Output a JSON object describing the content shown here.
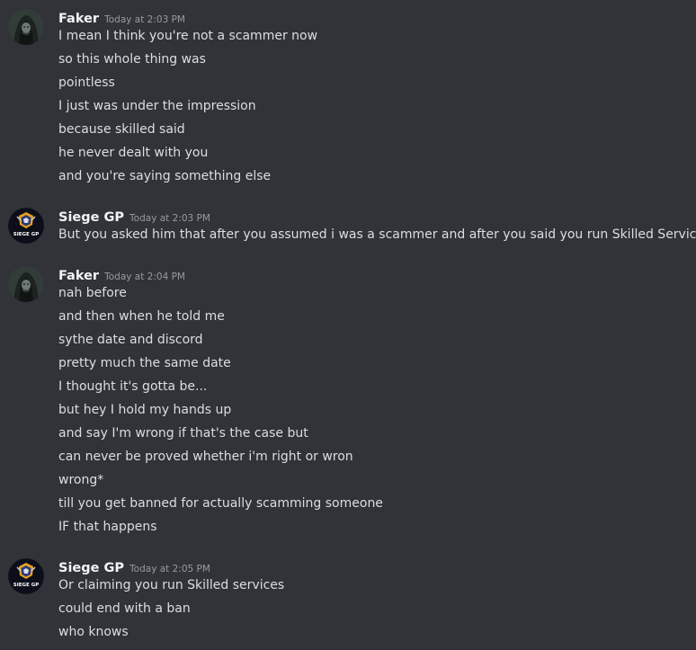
{
  "messages": [
    {
      "author": "Faker",
      "avatar_icon": "hooded-figure-avatar-icon",
      "timestamp": "Today at 2:03 PM",
      "lines": [
        "I mean I think you're not a scammer now",
        "so this whole thing was",
        "pointless",
        "I just was under the impression",
        "because skilled said",
        "he never dealt with you",
        "and you're saying something else"
      ]
    },
    {
      "author": "Siege GP",
      "avatar_icon": "siege-gp-logo-avatar-icon",
      "avatar_text": "SIEGE GP",
      "timestamp": "Today at 2:03 PM",
      "lines": [
        "But you asked him that after you assumed i was a scammer and after you said you run Skilled Services?"
      ]
    },
    {
      "author": "Faker",
      "avatar_icon": "hooded-figure-avatar-icon",
      "timestamp": "Today at 2:04 PM",
      "lines": [
        "nah before",
        "and then when he told me",
        "sythe date and discord",
        "pretty much the same date",
        "I thought it's gotta be...",
        "but hey I hold my hands up",
        "and say I'm wrong if that's the case but",
        "can never be proved whether i'm right or wron",
        "wrong*",
        "till you get banned for actually scamming someone",
        "IF that happens"
      ]
    },
    {
      "author": "Siege GP",
      "avatar_icon": "siege-gp-logo-avatar-icon",
      "avatar_text": "SIEGE GP",
      "timestamp": "Today at 2:05 PM",
      "lines": [
        "Or claiming you run Skilled services",
        "could end with a ban",
        "who knows"
      ]
    }
  ],
  "colors": {
    "background": "#313338",
    "username": "#f2f3f5",
    "message_text": "#dbdee1",
    "timestamp": "#949ba4"
  }
}
